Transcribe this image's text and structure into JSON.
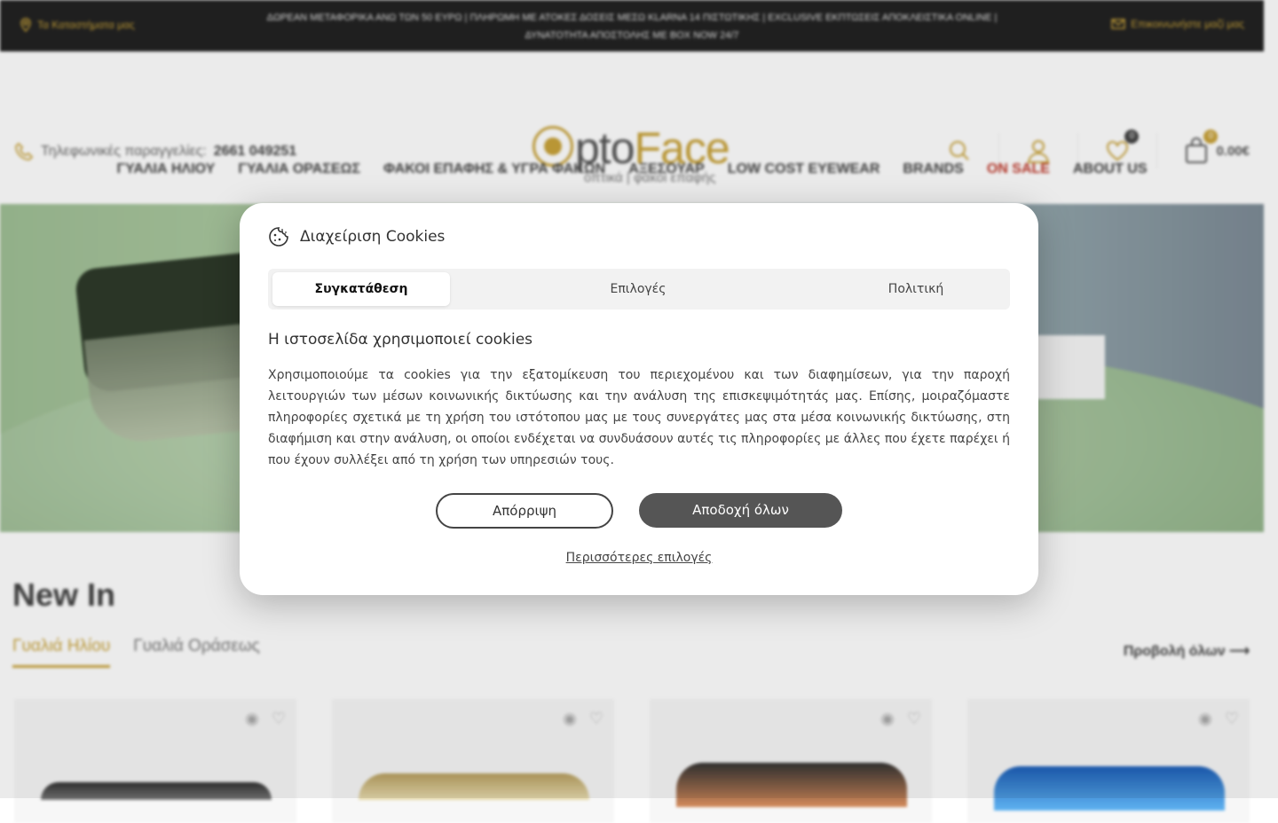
{
  "topbar": {
    "store_link": "Τα Καταστήματα μας",
    "promo_line1": "ΔΩΡΕΑΝ ΜΕΤΑΦΟΡΙΚΑ ΑΝΩ ΤΩΝ 50 ΕΥΡΩ | ΠΛΗΡΩΜΗ ΜΕ ΑΤΟΚΕΣ ΔΟΣΕΙΣ ΜΕΣΩ KLARNA 14 ΠΙΣΤΩΤΙΚΗΣ | EXCLUSIVE ΕΚΠΤΩΣΕΙΣ ΑΠΟΚΛΕΙΣΤΙΚΑ ONLINE |",
    "promo_line2": "ΔΥΝΑΤΟΤΗΤΑ ΑΠΟΣΤΟΛΗΣ ΜΕ BOX NOW 24/7",
    "contact_link": "Επικοινωνήστε μαζί μας"
  },
  "header": {
    "phone_label": "Τηλεφωνικές παραγγελίες:",
    "phone_number": "2661 049251",
    "logo_text_a": "pto",
    "logo_text_b": "Face",
    "logo_tagline": "οπτικά | φακοί επαφής",
    "wishlist_count": "0",
    "cart_count": "0",
    "cart_total": "0.00€"
  },
  "nav": {
    "items": [
      "ΓΥΑΛΙΑ ΗΛΙΟΥ",
      "ΓΥΑΛΙΑ ΟΡΑΣΕΩΣ",
      "ΦΑΚΟΙ ΕΠΑΦΗΣ & ΥΓΡΑ ΦΑΚΩΝ",
      "ΑΞΕΣΟΥΑΡ",
      "LOW COST EYEWEAR",
      "BRANDS",
      "ON SALE",
      "ABOUT US"
    ]
  },
  "section": {
    "title": "New In",
    "tabs": [
      "Γυαλιά Ηλίου",
      "Γυαλιά Οράσεως"
    ],
    "view_all": "Προβολή όλων"
  },
  "cookie": {
    "title": "Διαχείριση Cookies",
    "tabs": [
      "Συγκατάθεση",
      "Επιλογές",
      "Πολιτική"
    ],
    "heading": "Η ιστοσελίδα χρησιμοποιεί cookies",
    "body": "Χρησιμοποιούμε τα cookies για την εξατομίκευση του περιεχομένου και των διαφημίσεων, για την παροχή λειτουργιών των μέσων κοινωνικής δικτύωσης και την ανάλυση της επισκεψιμότητάς μας. Επίσης, μοιραζόμαστε πληροφορίες σχετικά με τη χρήση του ιστότοπου μας με τους συνεργάτες μας στα μέσα κοινωνικής δικτύωσης, στη διαφήμιση και στην ανάλυση, οι οποίοι ενδέχεται να συνδυάσουν αυτές τις πληροφορίες με άλλες που έχετε παρέχει ή που έχουν συλλέξει από τη χρήση των υπηρεσιών τους.",
    "reject": "Απόρριψη",
    "accept": "Αποδοχή όλων",
    "more": "Περισσότερες επιλογές"
  },
  "colors": {
    "accent_gold": "#c9a33a",
    "topbar_bg": "#222222",
    "sale_red": "#c0392b",
    "accept_bg": "#555555"
  }
}
